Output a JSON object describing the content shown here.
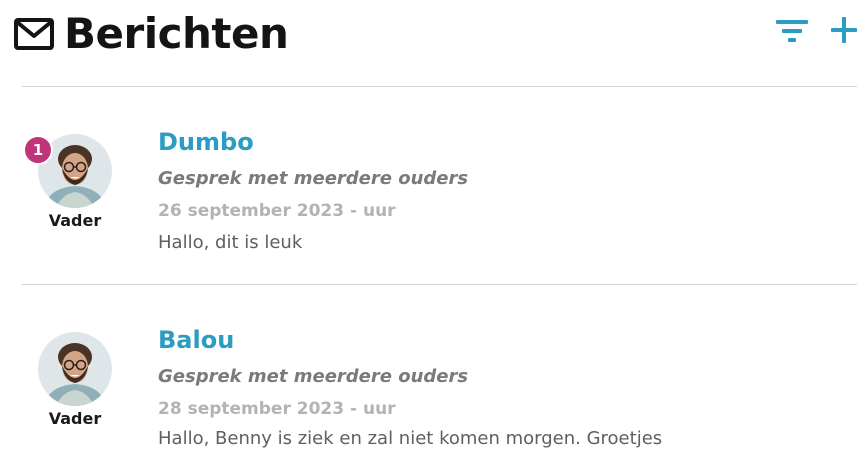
{
  "header": {
    "title": "Berichten",
    "title_icon": "mail-icon",
    "filter_icon": "filter-icon",
    "add_icon": "plus-icon"
  },
  "colors": {
    "accent": "#2b9dc2",
    "badge": "#c0357a",
    "divider": "#d4d4d4",
    "secondary_text": "#7a7a7a",
    "date_text": "#b3b3b3"
  },
  "conversations": [
    {
      "name": "Dumbo",
      "type": "Gesprek met meerdere ouders",
      "date": "26 september 2023 - uur",
      "preview": "Hallo, dit is leuk",
      "role": "Vader",
      "unread": "1"
    },
    {
      "name": "Balou",
      "type": "Gesprek met meerdere ouders",
      "date": "28 september 2023 - uur",
      "preview": "Hallo, Benny is ziek en zal niet komen morgen. Groetjes",
      "role": "Vader"
    }
  ]
}
